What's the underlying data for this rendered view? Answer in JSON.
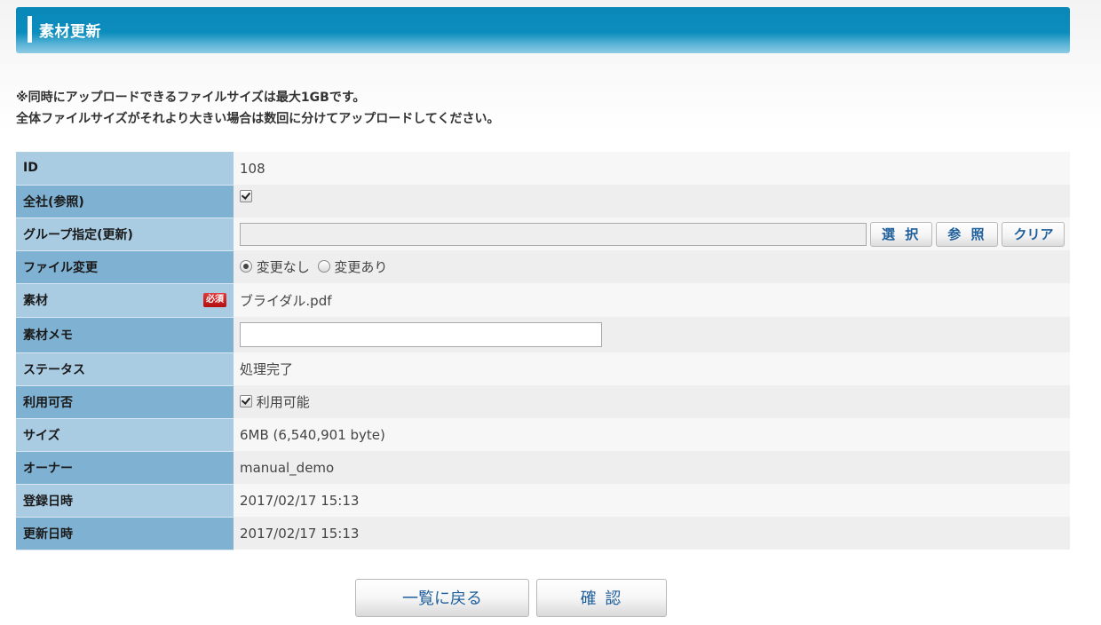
{
  "header": {
    "title": "素材更新"
  },
  "notice": {
    "line1_prefix": "※同時にアップロードできるファイルサイズは最大",
    "line1_bold": "1GB",
    "line1_suffix": "です。",
    "line2": "全体ファイルサイズがそれより大きい場合は数回に分けてアップロードしてください。"
  },
  "fields": {
    "id": {
      "label": "ID",
      "value": "108"
    },
    "company": {
      "label": "全社(参照)",
      "checked": true
    },
    "group": {
      "label": "グループ指定(更新)",
      "value": "",
      "select": "選 択",
      "browse": "参 照",
      "clear": "クリア"
    },
    "file_change": {
      "label": "ファイル変更",
      "opt_no": "変更なし",
      "opt_yes": "変更あり",
      "selected": "変更なし"
    },
    "material": {
      "label": "素材",
      "required": "必須",
      "value": "ブライダル.pdf"
    },
    "memo": {
      "label": "素材メモ",
      "value": ""
    },
    "status": {
      "label": "ステータス",
      "value": "処理完了"
    },
    "usable": {
      "label": "利用可否",
      "text": "利用可能",
      "checked": true
    },
    "size": {
      "label": "サイズ",
      "value": "6MB (6,540,901 byte)"
    },
    "owner": {
      "label": "オーナー",
      "value": "manual_demo"
    },
    "created": {
      "label": "登録日時",
      "value": "2017/02/17 15:13"
    },
    "updated": {
      "label": "更新日時",
      "value": "2017/02/17 15:13"
    }
  },
  "buttons": {
    "back": "一覧に戻る",
    "confirm": "確 認"
  },
  "colors": {
    "header": "#0b8dbd",
    "label_light": "#a9cce3",
    "label_dark": "#7fb1d2",
    "button_text": "#1f5f9c"
  }
}
